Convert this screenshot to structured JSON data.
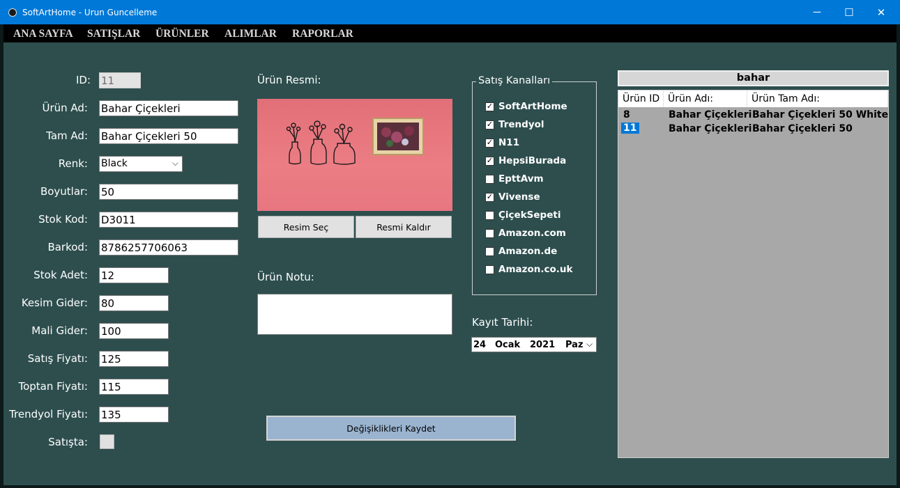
{
  "window": {
    "title": "SoftArtHome - Urun Guncelleme",
    "minimize": "─",
    "maximize": "☐",
    "close": "✕"
  },
  "menu": [
    "ANA SAYFA",
    "SATIŞLAR",
    "ÜRÜNLER",
    "ALIMLAR",
    "RAPORLAR"
  ],
  "form": {
    "id": {
      "label": "ID:",
      "value": "11"
    },
    "urun_ad": {
      "label": "Ürün Ad:",
      "value": "Bahar Çiçekleri"
    },
    "tam_ad": {
      "label": "Tam Ad:",
      "value": "Bahar Çiçekleri 50"
    },
    "renk": {
      "label": "Renk:",
      "value": "Black"
    },
    "boyutlar": {
      "label": "Boyutlar:",
      "value": "50"
    },
    "stok_kod": {
      "label": "Stok Kod:",
      "value": "D3011"
    },
    "barkod": {
      "label": "Barkod:",
      "value": "8786257706063"
    },
    "stok_adet": {
      "label": "Stok Adet:",
      "value": "12"
    },
    "kesim_gider": {
      "label": "Kesim Gider:",
      "value": "80"
    },
    "mali_gider": {
      "label": "Mali Gider:",
      "value": "100"
    },
    "satis_fiyati": {
      "label": "Satış Fiyatı:",
      "value": "125"
    },
    "toptan_fiyati": {
      "label": "Toptan Fiyatı:",
      "value": "115"
    },
    "trendyol_fiyati": {
      "label": "Trendyol Fiyatı:",
      "value": "135"
    },
    "satista": {
      "label": "Satışta:"
    }
  },
  "image_section": {
    "title": "Ürün Resmi:",
    "select_button": "Resim Seç",
    "remove_button": "Resmi Kaldır"
  },
  "note_section": {
    "title": "Ürün Notu:",
    "value": ""
  },
  "channels": {
    "title": "Satış Kanalları",
    "items": [
      {
        "label": "SoftArtHome",
        "checked": "✓"
      },
      {
        "label": "Trendyol",
        "checked": "✓"
      },
      {
        "label": "N11",
        "checked": "✓"
      },
      {
        "label": "HepsiBurada",
        "checked": "✓"
      },
      {
        "label": "EpttAvm",
        "checked": ""
      },
      {
        "label": "Vivense",
        "checked": "✓"
      },
      {
        "label": "ÇiçekSepeti",
        "checked": ""
      },
      {
        "label": "Amazon.com",
        "checked": ""
      },
      {
        "label": "Amazon.de",
        "checked": ""
      },
      {
        "label": "Amazon.co.uk",
        "checked": ""
      }
    ]
  },
  "date": {
    "label": "Kayıt Tarihi:",
    "day": "24",
    "month": "Ocak",
    "year": "2021",
    "weekday": "Paz"
  },
  "save_button": "Değişiklikleri Kaydet",
  "search": {
    "value": "bahar"
  },
  "list": {
    "columns": [
      "Ürün ID",
      "Ürün Adı:",
      "Ürün Tam Adı:"
    ],
    "rows": [
      {
        "id": "8",
        "name": "Bahar Çiçekleri",
        "full_name": "Bahar Çiçekleri 50 White"
      },
      {
        "id": "11",
        "name": "Bahar Çiçekleri",
        "full_name": "Bahar Çiçekleri 50"
      }
    ]
  },
  "colors": {
    "background": "#2e4e4e",
    "titlebar": "#0078d7",
    "selection": "#0078d7",
    "save_button": "#9ab4d0"
  }
}
